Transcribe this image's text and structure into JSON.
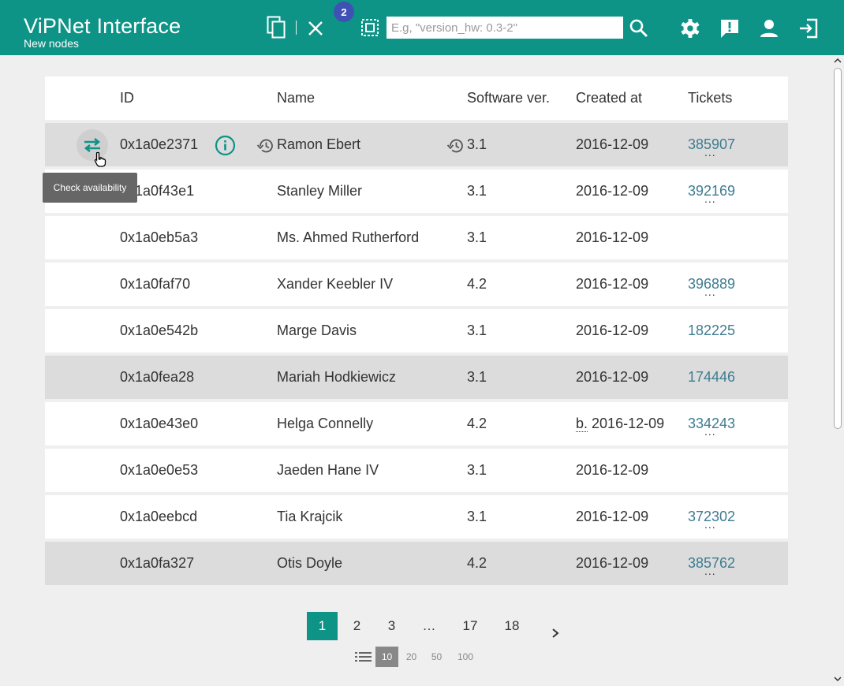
{
  "header": {
    "title": "ViPNet Interface",
    "subtitle": "New nodes",
    "badge_count": "2",
    "search_placeholder": "E.g, \"version_hw: 0.3-2\"",
    "search_value": ""
  },
  "table": {
    "columns": {
      "id": "ID",
      "name": "Name",
      "software": "Software ver.",
      "created": "Created at",
      "tickets": "Tickets"
    },
    "rows": [
      {
        "id": "0x1a0e2371",
        "name": "Ramon Ebert",
        "software": "3.1",
        "created": "2016-12-09",
        "ticket": "385907",
        "more": "..."
      },
      {
        "id": "0x1a0f43e1",
        "name": "Stanley Miller",
        "software": "3.1",
        "created": "2016-12-09",
        "ticket": "392169",
        "more": "..."
      },
      {
        "id": "0x1a0eb5a3",
        "name": "Ms. Ahmed Rutherford",
        "software": "3.1",
        "created": "2016-12-09",
        "ticket": "",
        "more": ""
      },
      {
        "id": "0x1a0faf70",
        "name": "Xander Keebler IV",
        "software": "4.2",
        "created": "2016-12-09",
        "ticket": "396889",
        "more": "..."
      },
      {
        "id": "0x1a0e542b",
        "name": "Marge Davis",
        "software": "3.1",
        "created": "2016-12-09",
        "ticket": "182225",
        "more": ""
      },
      {
        "id": "0x1a0fea28",
        "name": "Mariah Hodkiewicz",
        "software": "3.1",
        "created": "2016-12-09",
        "ticket": "174446",
        "more": ""
      },
      {
        "id": "0x1a0e43e0",
        "name": "Helga Connelly",
        "software": "4.2",
        "created_prefix": "b.",
        "created": "2016-12-09",
        "ticket": "334243",
        "more": "..."
      },
      {
        "id": "0x1a0e0e53",
        "name": "Jaeden Hane IV",
        "software": "3.1",
        "created": "2016-12-09",
        "ticket": "",
        "more": ""
      },
      {
        "id": "0x1a0eebcd",
        "name": "Tia Krajcik",
        "software": "3.1",
        "created": "2016-12-09",
        "ticket": "372302",
        "more": "..."
      },
      {
        "id": "0x1a0fa327",
        "name": "Otis Doyle",
        "software": "4.2",
        "created": "2016-12-09",
        "ticket": "385762",
        "more": "..."
      }
    ]
  },
  "tooltip": "Check availability",
  "pagination": {
    "pages": [
      "1",
      "2",
      "3",
      "…",
      "17",
      "18"
    ],
    "active_page": "1",
    "page_sizes": [
      "10",
      "20",
      "50",
      "100"
    ],
    "active_size": "10"
  },
  "colors": {
    "header": "#0d9487",
    "badge": "#3f51b5",
    "ticket_link": "#3d7c90",
    "row_highlight": "#dcdcdc"
  },
  "icons": [
    "copy-icon",
    "close-icon",
    "select-all-icon",
    "search-icon",
    "gear-icon",
    "feedback-icon",
    "user-icon",
    "logout-icon",
    "swap-icon",
    "info-icon",
    "history-icon",
    "chevron-right-icon",
    "list-icon"
  ]
}
